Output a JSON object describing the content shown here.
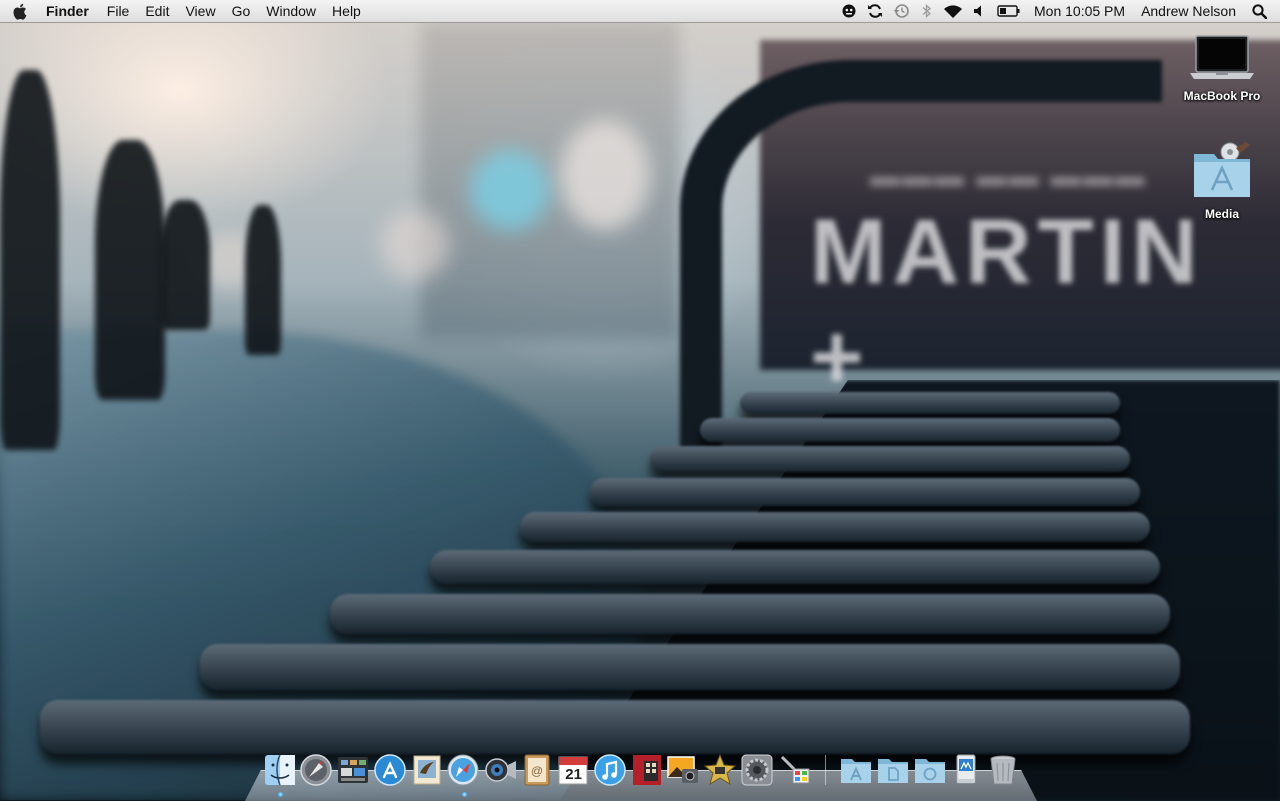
{
  "menubar": {
    "app_name": "Finder",
    "menus": [
      "File",
      "Edit",
      "View",
      "Go",
      "Window",
      "Help"
    ],
    "status_icons": [
      "user-switch-icon",
      "sync-icon",
      "time-machine-icon",
      "bluetooth-icon",
      "wifi-icon",
      "volume-icon",
      "battery-icon"
    ],
    "clock": "Mon 10:05 PM",
    "user": "Andrew Nelson"
  },
  "desktop": {
    "icons": [
      {
        "label": "MacBook Pro",
        "icon": "laptop-icon"
      },
      {
        "label": "Media",
        "icon": "media-folder-icon"
      }
    ]
  },
  "wallpaper": {
    "sign_text": "MARTIN +"
  },
  "dock": {
    "items": [
      {
        "name": "finder",
        "icon": "finder-icon",
        "running": true
      },
      {
        "name": "launchpad",
        "icon": "launchpad-icon"
      },
      {
        "name": "mission-control",
        "icon": "mission-control-icon"
      },
      {
        "name": "app-store",
        "icon": "app-store-icon"
      },
      {
        "name": "mail",
        "icon": "mail-icon"
      },
      {
        "name": "safari",
        "icon": "safari-icon",
        "running": true
      },
      {
        "name": "facetime",
        "icon": "facetime-icon"
      },
      {
        "name": "address-book",
        "icon": "address-book-icon"
      },
      {
        "name": "ical",
        "icon": "calendar-icon",
        "day": "21"
      },
      {
        "name": "itunes",
        "icon": "itunes-icon"
      },
      {
        "name": "photo-booth",
        "icon": "photo-booth-icon"
      },
      {
        "name": "iphoto",
        "icon": "iphoto-icon"
      },
      {
        "name": "imovie",
        "icon": "imovie-icon"
      },
      {
        "name": "system-preferences",
        "icon": "system-preferences-icon"
      },
      {
        "name": "boot-camp",
        "icon": "boot-camp-icon"
      }
    ],
    "stacks": [
      {
        "name": "applications",
        "icon": "applications-folder-icon"
      },
      {
        "name": "documents",
        "icon": "documents-folder-icon"
      },
      {
        "name": "downloads",
        "icon": "downloads-folder-icon"
      },
      {
        "name": "network-share",
        "icon": "network-drive-icon"
      },
      {
        "name": "trash",
        "icon": "trash-icon"
      }
    ],
    "accent": "#4fb0ff"
  }
}
